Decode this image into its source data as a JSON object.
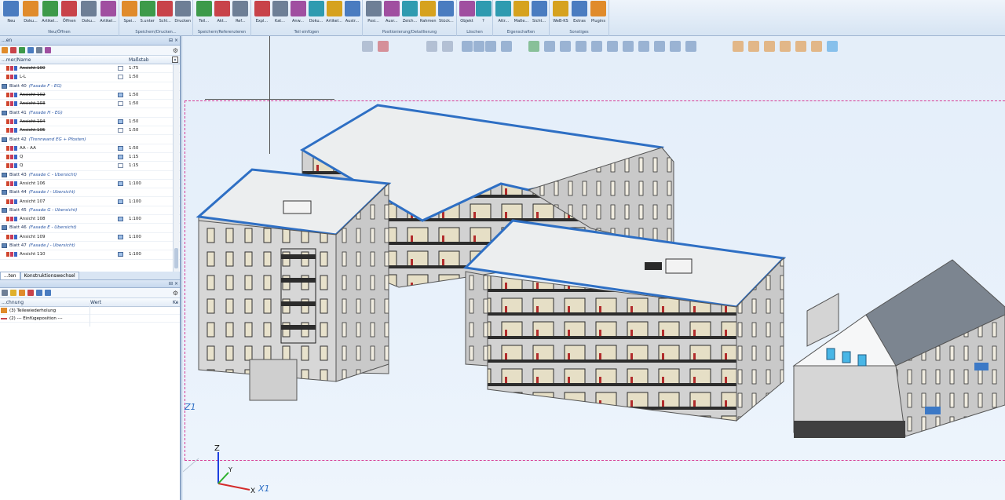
{
  "ribbon": {
    "groups": [
      {
        "title": "Neu/Öffnen",
        "buttons": [
          "Neu",
          "Doku...",
          "Artikel...",
          "Öffnen",
          "Doku...",
          "Artikel..."
        ]
      },
      {
        "title": "Speichern/Drucken...",
        "buttons": [
          "Spei...",
          "S.unter",
          "Schl...",
          "Drucken"
        ]
      },
      {
        "title": "Speichern/Referenzieren",
        "buttons": [
          "Teil...",
          "Akt...",
          "Ref..."
        ]
      },
      {
        "title": "Teil einfügen",
        "buttons": [
          "Expl...",
          "Kat...",
          "Anw...",
          "Doku...",
          "Artikel...",
          "Austr..."
        ]
      },
      {
        "title": "Positionierung/Detaillierung",
        "buttons": [
          "Posi...",
          "Ausr...",
          "Zeich...",
          "Rahmen",
          "Stück..."
        ]
      },
      {
        "title": "Löschen",
        "buttons": [
          "Objekt",
          "?"
        ]
      },
      {
        "title": "Eigenschaften",
        "buttons": [
          "Attr...",
          "Maße...",
          "Sicht..."
        ]
      },
      {
        "title": "Sonstiges",
        "buttons": [
          "WeB-KS",
          "Extras",
          "Plugins"
        ]
      }
    ]
  },
  "left_panel": {
    "title": "...en",
    "columns": {
      "name": "...mer/Name",
      "scale": "Maßstab"
    },
    "rows": [
      {
        "type": "view",
        "name": "Ansicht 100",
        "strike": true,
        "scale": "1:75",
        "blue": false
      },
      {
        "type": "view",
        "name": "L-L",
        "strike": false,
        "scale": "1:50",
        "blue": false
      },
      {
        "type": "sheet",
        "name": "Blatt 40",
        "sub": "(Fasade F - EG)"
      },
      {
        "type": "view",
        "name": "Ansicht 102",
        "strike": true,
        "scale": "1:50",
        "blue": true
      },
      {
        "type": "view",
        "name": "Ansicht 103",
        "strike": true,
        "scale": "1:50",
        "blue": false
      },
      {
        "type": "sheet",
        "name": "Blatt 41",
        "sub": "(Fasade H - EG)"
      },
      {
        "type": "view",
        "name": "Ansicht 104",
        "strike": true,
        "scale": "1:50",
        "blue": true
      },
      {
        "type": "view",
        "name": "Ansicht 105",
        "strike": true,
        "scale": "1:50",
        "blue": false
      },
      {
        "type": "sheet",
        "name": "Blatt 42",
        "sub": "(Trennwand EG + Pfosten)"
      },
      {
        "type": "view",
        "name": "AA - AA",
        "strike": false,
        "scale": "1:50",
        "blue": true
      },
      {
        "type": "view",
        "name": "Q",
        "strike": false,
        "scale": "1:15",
        "blue": true
      },
      {
        "type": "view",
        "name": "Q",
        "strike": false,
        "scale": "1:15",
        "blue": false
      },
      {
        "type": "sheet",
        "name": "Blatt 43",
        "sub": "(Fasade C - Übersicht)"
      },
      {
        "type": "view",
        "name": "Ansicht 106",
        "strike": false,
        "scale": "1:100",
        "blue": true
      },
      {
        "type": "sheet",
        "name": "Blatt 44",
        "sub": "(Fasade I - Übersicht)"
      },
      {
        "type": "view",
        "name": "Ansicht 107",
        "strike": false,
        "scale": "1:100",
        "blue": true
      },
      {
        "type": "sheet",
        "name": "Blatt 45",
        "sub": "(Fasade G - Übersicht)"
      },
      {
        "type": "view",
        "name": "Ansicht 108",
        "strike": false,
        "scale": "1:100",
        "blue": true
      },
      {
        "type": "sheet",
        "name": "Blatt 46",
        "sub": "(Fasade E - Übersicht)"
      },
      {
        "type": "view",
        "name": "Ansicht 109",
        "strike": false,
        "scale": "1:100",
        "blue": true
      },
      {
        "type": "sheet",
        "name": "Blatt 47",
        "sub": "(Fasade J - Übersicht)"
      },
      {
        "type": "view",
        "name": "Ansicht 110",
        "strike": false,
        "scale": "1:100",
        "blue": true
      }
    ],
    "tabs": [
      "...ten",
      "Konstruktionswechsel"
    ],
    "props_columns": {
      "name": "...chnung",
      "value": "Wert",
      "extra": "Ke"
    },
    "props_rows": [
      "(3) Teilewiederholung",
      "(2) --- Einfügeposition ---"
    ]
  },
  "viewport": {
    "axis_labels": {
      "z": "Z",
      "y": "Y",
      "x": "X",
      "x1": "X1",
      "z1": "Z1"
    }
  },
  "colors": {
    "accent": "#2e6fc4",
    "selection_dash": "#d63a94",
    "roof": "#eceeef",
    "wall": "#d9d9d9"
  }
}
